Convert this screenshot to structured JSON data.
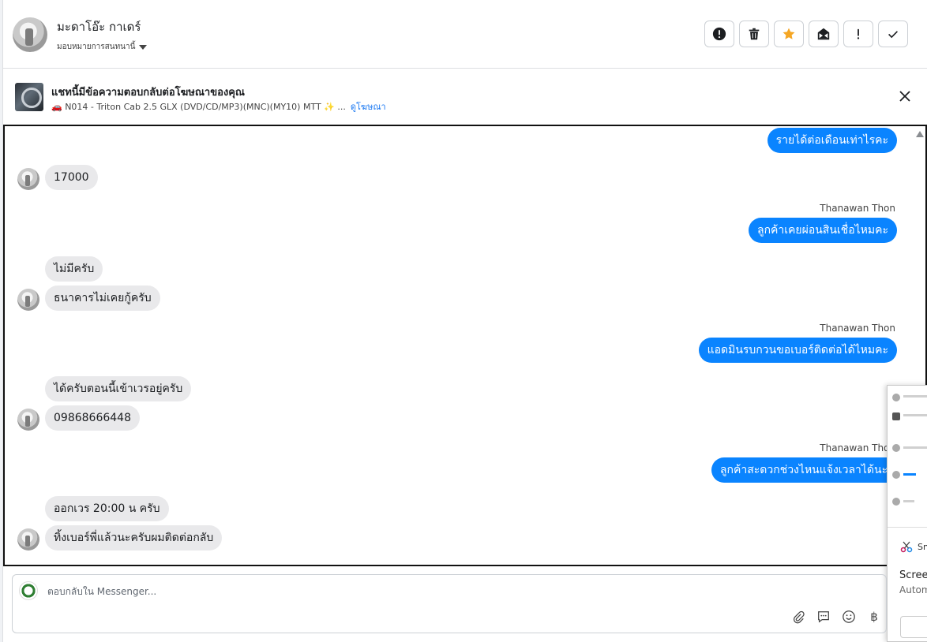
{
  "header": {
    "contact_name": "มะดาโอ๊ะ กาเดร์",
    "assign_label": "มอบหมายการสนทนานี้",
    "actions": [
      {
        "name": "report-spam-button",
        "icon": "exclamation-circle-icon"
      },
      {
        "name": "delete-button",
        "icon": "trash-icon"
      },
      {
        "name": "star-button",
        "icon": "star-icon",
        "color": "#f5a623"
      },
      {
        "name": "mark-unread-button",
        "icon": "envelope-icon"
      },
      {
        "name": "follow-up-button",
        "icon": "exclamation-icon"
      },
      {
        "name": "mark-done-button",
        "icon": "check-icon"
      }
    ]
  },
  "ad_banner": {
    "title": "แชทนี้มีข้อความตอบกลับต่อโฆษณาของคุณ",
    "ad_text": "🚗 N014 - Triton Cab 2.5 GLX (DVD/CD/MP3)(MNC)(MY10) MTT ✨ ...",
    "view_ad_link": "ดูโฆษณา"
  },
  "conversation": {
    "messages": [
      {
        "direction": "out",
        "text": "รายได้ต่อเดือนเท่าไรคะ"
      },
      {
        "direction": "in",
        "text": "17000"
      },
      {
        "direction": "out",
        "sender": "Thanawan Thon",
        "text": "ลูกค้าเคยผ่อนสินเชื่อไหมคะ"
      },
      {
        "direction": "in",
        "text": "ไม่มีครับ"
      },
      {
        "direction": "in",
        "text": "ธนาคารไม่เคยกู้ครับ"
      },
      {
        "direction": "out",
        "sender": "Thanawan Thon",
        "text": "แอดมินรบกวนขอเบอร์ติดต่อได้ไหมคะ"
      },
      {
        "direction": "in",
        "text": "ได้ครับตอนนี้เข้าเวรอยู่ครับ"
      },
      {
        "direction": "in",
        "text": "09868666448"
      },
      {
        "direction": "out",
        "sender": "Thanawan Thon",
        "text": "ลูกค้าสะดวกช่วงไหนแจ้งเวลาได้นะคะ"
      },
      {
        "direction": "in",
        "text": "ออกเวร 20:00 น ครับ"
      },
      {
        "direction": "in",
        "text": "ทิ้งเบอร์พี่แล้วนะครับผมติดต่อกลับ"
      }
    ],
    "colors": {
      "outgoing": "#0a84ff",
      "incoming": "#e9e9eb"
    }
  },
  "overlay": {
    "app_label": "Sn",
    "line1": "Screen",
    "line2": "Autom"
  },
  "composer": {
    "placeholder": "ตอบกลับใน Messenger...",
    "tools": [
      "paperclip-icon",
      "saved-reply-icon",
      "emoji-icon",
      "baht-icon"
    ],
    "baht_symbol": "฿"
  }
}
